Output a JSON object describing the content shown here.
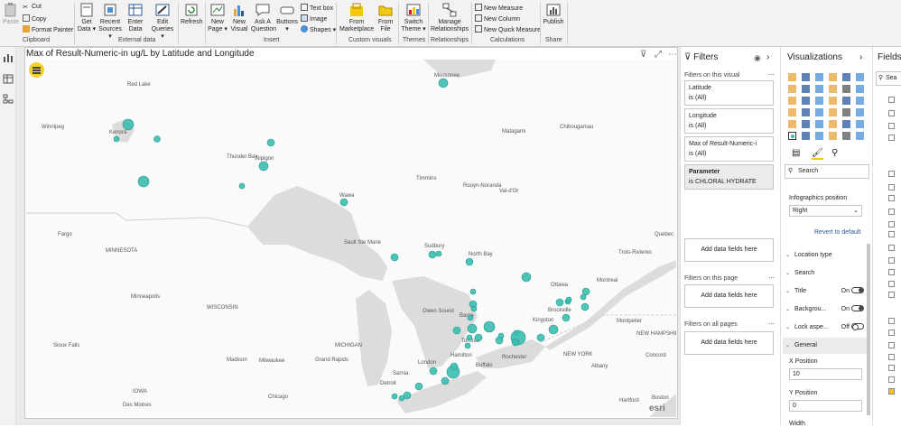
{
  "ribbon": {
    "paste": "Paste",
    "cut": "Cut",
    "copy": "Copy",
    "format_painter": "Format Painter",
    "clipboard_group": "Clipboard",
    "get_data": "Get Data ▾",
    "recent_sources": "Recent Sources ▾",
    "enter_data": "Enter Data",
    "edit_queries": "Edit Queries ▾",
    "external_data_group": "External data",
    "refresh": "Refresh",
    "new_page": "New Page ▾",
    "new_visual": "New Visual",
    "ask_question": "Ask A Question",
    "buttons": "Buttons ▾",
    "text_box": "Text box",
    "image": "Image",
    "shapes": "Shapes ▾",
    "insert_group": "Insert",
    "from_marketplace": "From Marketplace",
    "from_file": "From File",
    "custom_visuals_group": "Custom visuals",
    "switch_theme": "Switch Theme ▾",
    "themes_group": "Themes",
    "manage_relationships": "Manage Relationships",
    "relationships_group": "Relationships",
    "new_measure": "New Measure",
    "new_column": "New Column",
    "new_quick_measure": "New Quick Measure",
    "calculations_group": "Calculations",
    "publish": "Publish",
    "share_group": "Share"
  },
  "visual": {
    "title": "Max of Result-Numeric-in ug/L by Latitude and Longitude",
    "esri": "esri"
  },
  "map_labels": {
    "red_lake": "Red Lake",
    "winnipeg": "Winnipeg",
    "kenora": "Kenora",
    "moosonee": "Moosonee",
    "matagami": "Matagami",
    "chibougamau": "Chibougamau",
    "nipigon": "Nipigon",
    "thunder_bay": "Thunder Bay",
    "wawa": "Wawa",
    "timmins": "Timmins",
    "rouyn": "Rouyn-Noranda",
    "val_dor": "Val-d'Or",
    "fargo": "Fargo",
    "sault_ste_marie": "Sault Ste Marie",
    "sudbury": "Sudbury",
    "north_bay": "North Bay",
    "minnesota": "MINNESOTA",
    "quebec": "Quebec",
    "trois_rivieres": "Trois-Rivieres",
    "ottawa": "Ottawa",
    "montreal": "Montreal",
    "minneapolis": "Minneapolis",
    "wisconsin": "WISCONSIN",
    "owen_sound": "Owen Sound",
    "barrie": "Barrie",
    "brockville": "Brockville",
    "kingston": "Kingston",
    "montpelier": "Montpelier",
    "new_hampshire": "NEW HAMPSHIRE",
    "sioux_falls": "Sioux Falls",
    "michigan": "MICHIGAN",
    "toronto": "Toronto",
    "concord": "Concord",
    "madison": "Madison",
    "milwaukee": "Milwaukee",
    "grand_rapids": "Grand Rapids",
    "london": "London",
    "hamilton": "Hamilton",
    "buffalo": "Buffalo",
    "rochester": "Rochester",
    "new_york": "NEW YORK",
    "albany": "Albany",
    "sarnia": "Sarnia",
    "detroit": "Detroit",
    "iowa": "IOWA",
    "chicago": "Chicago",
    "des_moines": "Des Moines",
    "hartford": "Hartford",
    "boston": "Boston"
  },
  "filters_pane": {
    "title": "Filters",
    "on_visual": "Filters on this visual",
    "cards": [
      {
        "name": "Latitude",
        "value": "is (All)"
      },
      {
        "name": "Longitude",
        "value": "is (All)"
      },
      {
        "name": "Max of Result-Numeric-i",
        "value": "is (All)"
      },
      {
        "name": "Parameter",
        "value": "is CHLORAL HYDRATE"
      }
    ],
    "add_visual": "Add data fields here",
    "on_page": "Filters on this page",
    "add_page": "Add data fields here",
    "on_all_pages": "Filters on all pages",
    "add_all": "Add data fields here"
  },
  "viz_pane": {
    "title": "Visualizations",
    "search": "Search",
    "infographics_position": "Infographics position",
    "position_value": "Right",
    "revert": "Revert to default",
    "sections": [
      {
        "label": "Location type",
        "toggle": ""
      },
      {
        "label": "Search",
        "toggle": ""
      },
      {
        "label": "Title",
        "toggle": "On"
      },
      {
        "label": "Backgrou...",
        "toggle": "On"
      },
      {
        "label": "Lock aspe...",
        "toggle": "Off"
      }
    ],
    "general": "General",
    "x_position_label": "X Position",
    "x_position_value": "10",
    "y_position_label": "Y Position",
    "y_position_value": "0",
    "width_label": "Width"
  },
  "fields_pane": {
    "title": "Fields",
    "search": "Sea"
  },
  "colors": {
    "bubble": "#3dbcb0",
    "bubble_stroke": "#1e9c91",
    "water": "#dcdcdc",
    "land": "#fafafa",
    "accent": "#f2c811"
  }
}
